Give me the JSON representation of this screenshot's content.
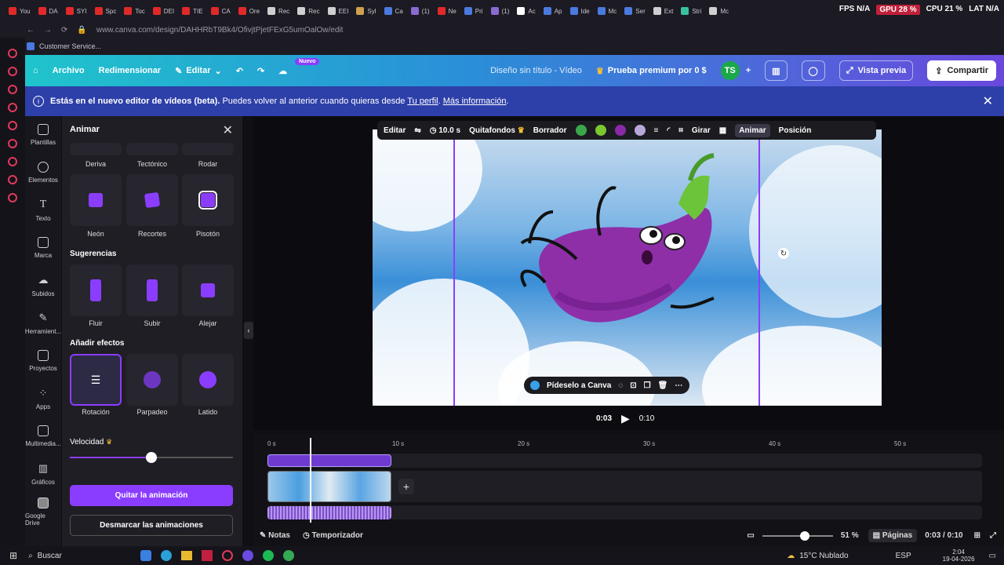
{
  "browser": {
    "tabs": [
      "You",
      "DA",
      "SYI",
      "Spc",
      "Toc",
      "DEI",
      "TIE",
      "CA",
      "Ore",
      "Rec",
      "Rec",
      "EEI",
      "Syl",
      "Ca",
      "(1)",
      "Ne",
      "Pri",
      "(1)",
      "Ac",
      "Ap",
      "Ide",
      "Mc",
      "Ser",
      "Ext",
      "Stri",
      "Mc"
    ],
    "tab_colors": [
      "#e02a2a",
      "#e02a2a",
      "#e02a2a",
      "#e02a2a",
      "#e02a2a",
      "#e02a2a",
      "#e02a2a",
      "#e02a2a",
      "#e02a2a",
      "#cfcfcf",
      "#cfcfcf",
      "#cfcfcf",
      "#d0a050",
      "#4a7ae0",
      "#8a6ad0",
      "#e02a2a",
      "#4a7ae0",
      "#8a6ad0",
      "#ffffff",
      "#4a7ae0",
      "#4a7ae0",
      "#4a7ae0",
      "#4a7ae0",
      "#cfcfcf",
      "#3ac0a0",
      "#cfcfcf"
    ],
    "url": "www.canva.com/design/DAHHRbT9Bk4/OfivjtPjetFExG5umOalOw/edit",
    "bookmark": "Customer Service...",
    "hud": {
      "fps": "FPS N/A",
      "gpu": "GPU 28 %",
      "cpu": "CPU 21 %",
      "lat": "LAT N/A"
    }
  },
  "header": {
    "archivo": "Archivo",
    "redimensionar": "Redimensionar",
    "editar": "Editar",
    "nuevo_badge": "Nuevo",
    "design_title": "Diseño sin título - Vídeo",
    "premium": "Prueba premium por 0 $",
    "avatar": "TS",
    "vista_previa": "Vista previa",
    "compartir": "Compartir"
  },
  "banner": {
    "bold": "Estás en el nuevo editor de vídeos (beta).",
    "text": " Puedes volver al anterior cuando quieras desde ",
    "link1": "Tu perfil",
    "sep": ". ",
    "link2": "Más información",
    "end": "."
  },
  "nav": [
    {
      "label": "Plantillas"
    },
    {
      "label": "Elementos"
    },
    {
      "label": "Texto"
    },
    {
      "label": "Marca"
    },
    {
      "label": "Subidos"
    },
    {
      "label": "Herramient..."
    },
    {
      "label": "Proyectos"
    },
    {
      "label": "Apps"
    },
    {
      "label": "Multimedia..."
    },
    {
      "label": "Gráficos"
    },
    {
      "label": "Google Drive"
    }
  ],
  "panel": {
    "title": "Animar",
    "top_labels": [
      "Deriva",
      "Tectónico",
      "Rodar"
    ],
    "row2": [
      "Neón",
      "Recortes",
      "Pisotón"
    ],
    "sugerencias": "Sugerencias",
    "row3": [
      "Fluir",
      "Subir",
      "Alejar"
    ],
    "efectos": "Añadir efectos",
    "row4": [
      "Rotación",
      "Parpadeo",
      "Latido"
    ],
    "velocidad": "Velocidad",
    "velocidad_fraction": 0.5,
    "quitar": "Quitar la animación",
    "desmarcar": "Desmarcar las animaciones"
  },
  "canvas_toolbar": {
    "editar": "Editar",
    "duracion": "10.0 s",
    "quitafondos": "Quitafondos",
    "borrador": "Borrador",
    "colors": [
      "#3aa84a",
      "#7ac830",
      "#8a2aa8",
      "#b8a8d8"
    ],
    "girar": "Girar",
    "animar": "Animar",
    "posicion": "Posición"
  },
  "element_toolbar": {
    "pidelo": "Pídeselo a Canva"
  },
  "playback": {
    "current": "0:03",
    "total": "0:10"
  },
  "timeline": {
    "ticks": [
      "0 s",
      "10 s",
      "20 s",
      "30 s",
      "40 s",
      "50 s"
    ],
    "playhead_seconds": 3
  },
  "bottom": {
    "notas": "Notas",
    "temporizador": "Temporizador",
    "zoom": "51 %",
    "zoom_fraction": 0.62,
    "paginas": "Páginas",
    "time": "0:03 / 0:10"
  },
  "taskbar": {
    "buscar": "Buscar",
    "weather": "15°C Nublado",
    "lang": "ESP",
    "time": "2:04",
    "date": "19-04-2026"
  }
}
